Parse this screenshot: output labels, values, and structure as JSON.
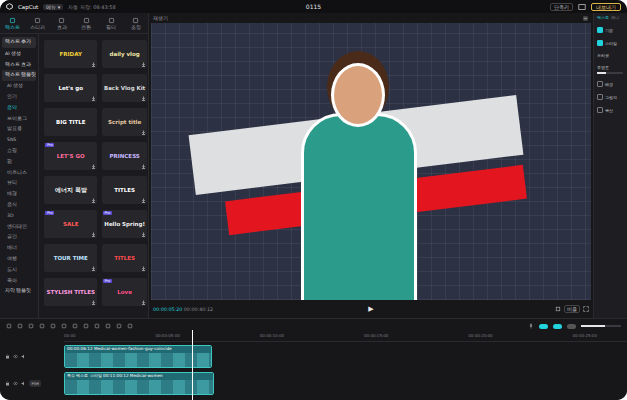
{
  "window": {
    "title": "0115"
  },
  "top_bar": {
    "logo": "CapCut",
    "menu": "메뉴",
    "menu_arrow": "▾",
    "autosave": "자동 저장: 09:43:58",
    "shortcut": "단축키",
    "export": "내보내기"
  },
  "tool_tabs": [
    {
      "label": "텍스트",
      "selected": true
    },
    {
      "label": "스티커",
      "selected": false
    },
    {
      "label": "효과",
      "selected": false
    },
    {
      "label": "전환",
      "selected": false
    },
    {
      "label": "필터",
      "selected": false
    },
    {
      "label": "조정",
      "selected": false
    }
  ],
  "categories": [
    {
      "label": "텍스트 추가",
      "kind": "button",
      "selected": false
    },
    {
      "label": "AI 생성",
      "kind": "group",
      "selected": false
    },
    {
      "label": "텍스트 효과",
      "kind": "group",
      "selected": false
    },
    {
      "label": "텍스트 템플릿",
      "kind": "group",
      "selected": true
    },
    {
      "label": "AI 생성",
      "kind": "item",
      "selected": false
    },
    {
      "label": "인기",
      "kind": "item",
      "selected": false
    },
    {
      "label": "음악",
      "kind": "item",
      "selected": true
    },
    {
      "label": "브이로그",
      "kind": "item",
      "selected": false
    },
    {
      "label": "발표용",
      "kind": "item",
      "selected": false
    },
    {
      "label": "SNS",
      "kind": "item",
      "selected": false
    },
    {
      "label": "쇼핑",
      "kind": "item",
      "selected": false
    },
    {
      "label": "팝",
      "kind": "item",
      "selected": false
    },
    {
      "label": "비즈니스",
      "kind": "item",
      "selected": false
    },
    {
      "label": "뷰티",
      "kind": "item",
      "selected": false
    },
    {
      "label": "배경",
      "kind": "item",
      "selected": false
    },
    {
      "label": "음식",
      "kind": "item",
      "selected": false
    },
    {
      "label": "3D",
      "kind": "item",
      "selected": false
    },
    {
      "label": "엔터테인",
      "kind": "item",
      "selected": false
    },
    {
      "label": "공간",
      "kind": "item",
      "selected": false
    },
    {
      "label": "배너",
      "kind": "item",
      "selected": false
    },
    {
      "label": "여행",
      "kind": "item",
      "selected": false
    },
    {
      "label": "도시",
      "kind": "item",
      "selected": false
    },
    {
      "label": "육아",
      "kind": "item",
      "selected": false
    },
    {
      "label": "자막 템플릿",
      "kind": "group",
      "selected": false
    }
  ],
  "pro_badge": "Pro",
  "templates": [
    {
      "label": "FRIDAY",
      "color": "#f5d33a",
      "pro": false,
      "downloaded": false
    },
    {
      "label": "daily vlog",
      "color": "#f2e6a6",
      "pro": false,
      "downloaded": false
    },
    {
      "label": "Let's go",
      "color": "#ffffff",
      "pro": false,
      "downloaded": false
    },
    {
      "label": "Back Vlog Kit",
      "color": "#d9d9d9",
      "pro": false,
      "downloaded": false
    },
    {
      "label": "BIG TITLE",
      "color": "#ffffff",
      "pro": false,
      "downloaded": true
    },
    {
      "label": "Script title",
      "color": "#e8c9a0",
      "pro": false,
      "downloaded": false
    },
    {
      "label": "LET'S GO",
      "color": "#ff6b9a",
      "pro": true,
      "downloaded": false
    },
    {
      "label": "PRINCESS",
      "color": "#c8b6ff",
      "pro": false,
      "downloaded": false
    },
    {
      "label": "에너지 폭발",
      "color": "#ffffff",
      "pro": false,
      "downloaded": false
    },
    {
      "label": "TITLES",
      "color": "#ffffff",
      "pro": false,
      "downloaded": false
    },
    {
      "label": "SALE",
      "color": "#ff5a5a",
      "pro": true,
      "downloaded": false
    },
    {
      "label": "Hello Spring!",
      "color": "#f0f0f0",
      "pro": true,
      "downloaded": false
    },
    {
      "label": "TOUR TIME",
      "color": "#bfe3ff",
      "pro": false,
      "downloaded": false
    },
    {
      "label": "TITLES",
      "color": "#ff4d4d",
      "pro": false,
      "downloaded": false
    },
    {
      "label": "STYLISH TITLES",
      "color": "#ff9be0",
      "pro": false,
      "downloaded": false
    },
    {
      "label": "Love",
      "color": "#ff4f87",
      "pro": true,
      "downloaded": false
    }
  ],
  "player": {
    "title": "재생기",
    "current_time": "00:00:05:20",
    "total_time": "00:00:40:12",
    "play": "▶",
    "ratio": "비율"
  },
  "inspector": {
    "tabs": [
      {
        "label": "텍스트",
        "selected": true
      },
      {
        "label": "애니",
        "selected": false
      }
    ],
    "rows": [
      {
        "label": "기본",
        "kind": "check",
        "checked": true
      },
      {
        "label": "스타일",
        "kind": "check",
        "checked": true
      },
      {
        "label": "프리셋",
        "kind": "label"
      },
      {
        "label": "투명도",
        "kind": "slider",
        "level": 0.35
      },
      {
        "label": "배경",
        "kind": "check",
        "checked": false
      },
      {
        "label": "그림자",
        "kind": "check",
        "checked": false
      },
      {
        "label": "곡선",
        "kind": "check",
        "checked": false
      }
    ]
  },
  "timeline": {
    "ruler": [
      "00:00",
      "00:00:05:00",
      "00:00:10:00",
      "00:00:15:00",
      "00:00:20:00",
      "00:00:25:00"
    ],
    "zoom_level": 0.6,
    "cover": "커버",
    "clips": [
      {
        "label": "00:00:06:12 Medical-women-fashion-guy-coincide",
        "kind": "text"
      },
      {
        "label": "특수 텍스트 스타일 00:11:00:12 Medical-women",
        "kind": "video"
      }
    ]
  }
}
